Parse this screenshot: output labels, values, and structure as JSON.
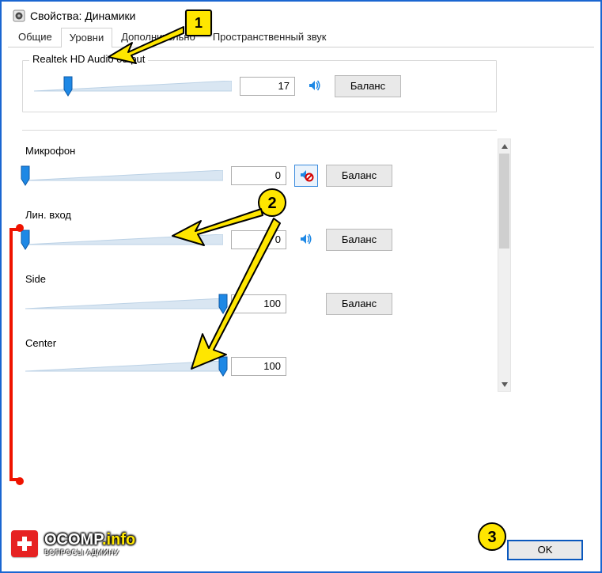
{
  "window": {
    "title": "Свойства: Динамики"
  },
  "tabs": [
    "Общие",
    "Уровни",
    "Дополнительно",
    "Пространственный звук"
  ],
  "active_tab": 1,
  "main_output": {
    "label": "Realtek HD Audio output",
    "value": 17,
    "balance": "Баланс",
    "muted": false
  },
  "channels": [
    {
      "label": "Микрофон",
      "value": 0,
      "muted": true,
      "balance": "Баланс",
      "show_balance": true,
      "show_icon": true
    },
    {
      "label": "Лин. вход",
      "value": 0,
      "muted": false,
      "balance": "Баланс",
      "show_balance": true,
      "show_icon": true
    },
    {
      "label": "Side",
      "value": 100,
      "muted": false,
      "balance": "Баланс",
      "show_balance": true,
      "show_icon": false
    },
    {
      "label": "Center",
      "value": 100,
      "muted": false,
      "balance": "Баланс",
      "show_balance": false,
      "show_icon": false
    }
  ],
  "buttons": {
    "ok": "OK"
  },
  "annotations": {
    "badges": [
      "1",
      "2",
      "3"
    ]
  },
  "watermark": {
    "brand": "OCOMP",
    "suffix": ".info",
    "sub": "ВОПРОСЫ АДМИНУ"
  }
}
